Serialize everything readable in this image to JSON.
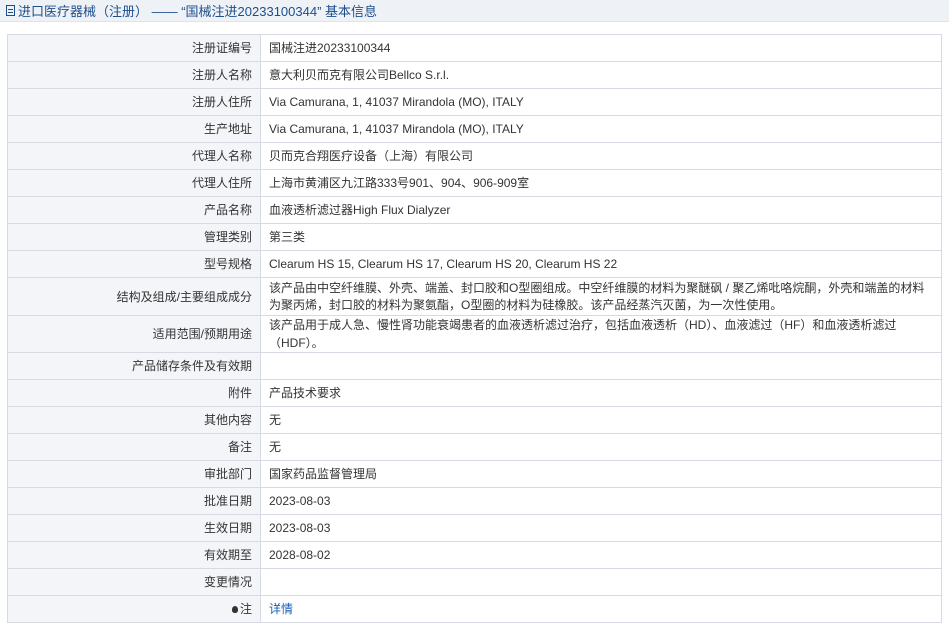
{
  "header": {
    "title": "进口医疗器械（注册） —— “国械注进20233100344” 基本信息"
  },
  "rows": [
    {
      "label": "注册证编号",
      "value": "国械注进20233100344"
    },
    {
      "label": "注册人名称",
      "value": "意大利贝而克有限公司Bellco S.r.l."
    },
    {
      "label": "注册人住所",
      "value": "Via Camurana, 1, 41037 Mirandola (MO), ITALY"
    },
    {
      "label": "生产地址",
      "value": "Via Camurana, 1, 41037 Mirandola (MO), ITALY"
    },
    {
      "label": "代理人名称",
      "value": "贝而克合翔医疗设备（上海）有限公司"
    },
    {
      "label": "代理人住所",
      "value": "上海市黄浦区九江路333号901、904、906-909室"
    },
    {
      "label": "产品名称",
      "value": "血液透析滤过器High Flux Dialyzer"
    },
    {
      "label": "管理类别",
      "value": "第三类"
    },
    {
      "label": "型号规格",
      "value": "Clearum HS 15, Clearum HS 17, Clearum HS 20, Clearum HS 22"
    },
    {
      "label": "结构及组成/主要组成成分",
      "value": "该产品由中空纤维膜、外壳、端盖、封口胶和O型圈组成。中空纤维膜的材料为聚醚砜 / 聚乙烯吡咯烷酮，外壳和端盖的材料为聚丙烯，封口胶的材料为聚氨酯，O型圈的材料为硅橡胶。该产品经蒸汽灭菌，为一次性使用。"
    },
    {
      "label": "适用范围/预期用途",
      "value": "该产品用于成人急、慢性肾功能衰竭患者的血液透析滤过治疗，包括血液透析（HD）、血液滤过（HF）和血液透析滤过（HDF）。"
    },
    {
      "label": "产品储存条件及有效期",
      "value": ""
    },
    {
      "label": "附件",
      "value": "产品技术要求"
    },
    {
      "label": "其他内容",
      "value": "无"
    },
    {
      "label": "备注",
      "value": "无"
    },
    {
      "label": "审批部门",
      "value": "国家药品监督管理局"
    },
    {
      "label": "批准日期",
      "value": "2023-08-03"
    },
    {
      "label": "生效日期",
      "value": "2023-08-03"
    },
    {
      "label": "有效期至",
      "value": "2028-08-02"
    },
    {
      "label": "变更情况",
      "value": ""
    }
  ],
  "note_row": {
    "label": "注",
    "icon": "bulb-icon",
    "link_text": "详情"
  },
  "colors": {
    "title_text": "#1d4f8c",
    "label_bg": "#f3f5f8",
    "border": "#d6dbe3",
    "link": "#1a5fb4"
  }
}
